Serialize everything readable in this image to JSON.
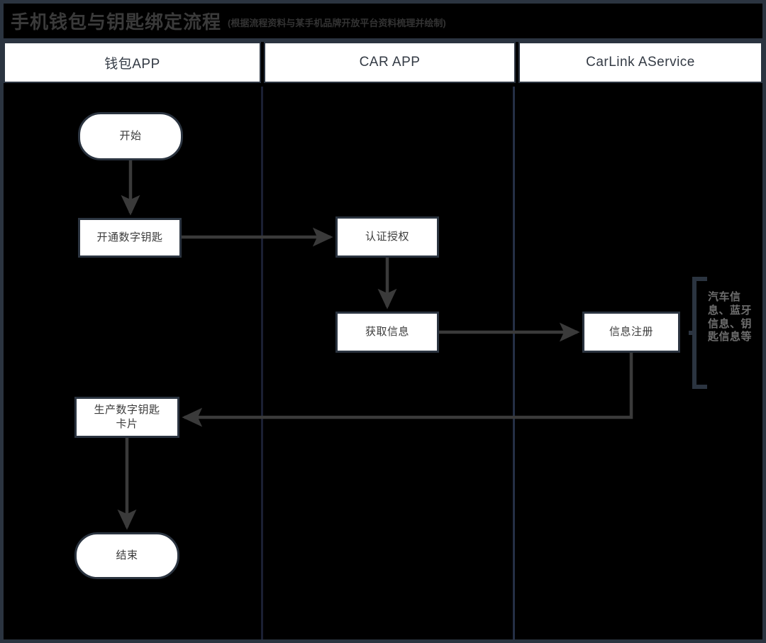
{
  "title": {
    "main": "手机钱包与钥匙绑定流程",
    "sub": "(根据流程资料与某手机品牌开放平台资料梳理并绘制)"
  },
  "lanes": [
    {
      "label": "钱包APP"
    },
    {
      "label": "CAR APP"
    },
    {
      "label": "CarLink AService"
    }
  ],
  "nodes": {
    "start": {
      "label": "开始",
      "shape": "terminator",
      "lane": 0
    },
    "open": {
      "label": "开通数字钥匙",
      "shape": "process",
      "lane": 0
    },
    "auth": {
      "label": "认证授权",
      "shape": "process",
      "lane": 1
    },
    "fetch": {
      "label": "获取信息",
      "shape": "process",
      "lane": 1
    },
    "register": {
      "label": "信息注册",
      "shape": "process",
      "lane": 2
    },
    "produce": {
      "label": "生产数字钥匙\n卡片",
      "shape": "process",
      "lane": 0
    },
    "end": {
      "label": "结束",
      "shape": "terminator",
      "lane": 0
    }
  },
  "annotation": {
    "text": "汽车信息、蓝牙信息、钥匙信息等"
  },
  "colors": {
    "background": "#000000",
    "frame": "#2b3440",
    "node_fill": "#ffffff",
    "node_stroke": "#2b3440",
    "connector": "#3a3a3a",
    "lane_divider_1": "#1a1f33",
    "lane_divider_2": "#242f45",
    "title_text": "#3a3a3a",
    "annotation_text": "#6d6d6d"
  }
}
